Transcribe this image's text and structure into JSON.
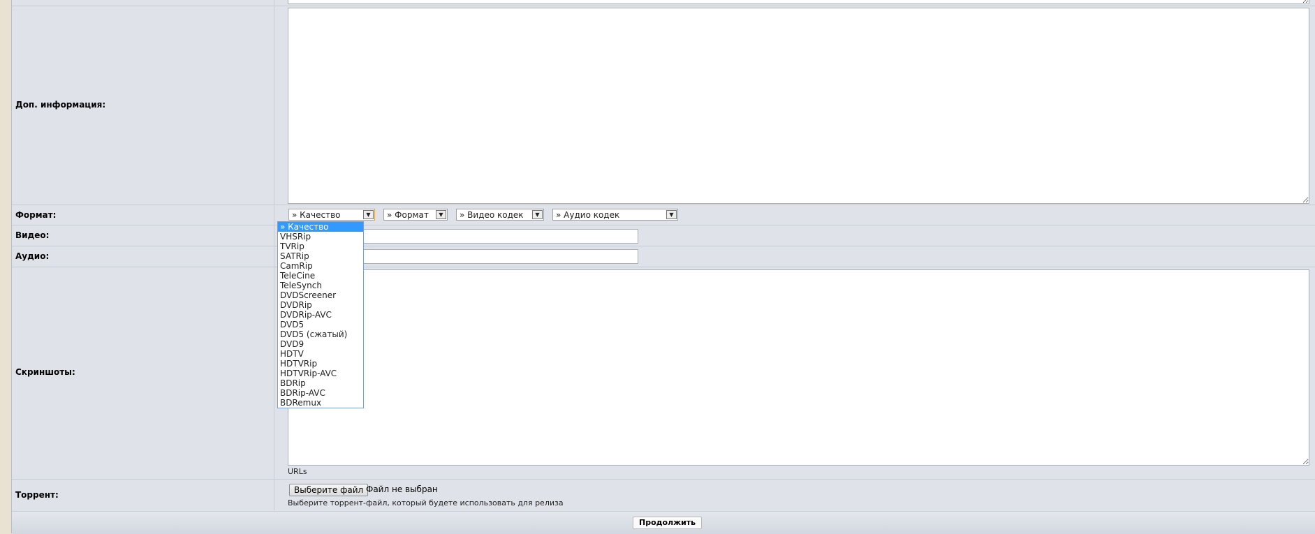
{
  "form": {
    "info_label": "Доп. информация:",
    "format_label": "Формат:",
    "video_label": "Видео:",
    "audio_label": "Аудио:",
    "screens_label": "Скриншоты:",
    "torrent_label": "Торрент:",
    "selects": {
      "quality": "» Качество",
      "format": "» Формат",
      "video_codec": "» Видео кодек",
      "audio_codec": "» Аудио кодек"
    },
    "quality_options": [
      "» Качество",
      "VHSRip",
      "TVRip",
      "SATRip",
      "CamRip",
      "TeleCine",
      "TeleSynch",
      "DVDScreener",
      "DVDRip",
      "DVDRip-AVC",
      "DVD5",
      "DVD5 (сжатый)",
      "DVD9",
      "HDTV",
      "HDTVRip",
      "HDTVRip-AVC",
      "BDRip",
      "BDRip-AVC",
      "BDRemux"
    ],
    "urls_hint": "URLs",
    "file_button": "Выберите файл",
    "file_status": "Файл не выбран",
    "torrent_hint": "Выберите торрент-файл, который будете использовать для релиза",
    "continue_button": "Продолжить"
  }
}
